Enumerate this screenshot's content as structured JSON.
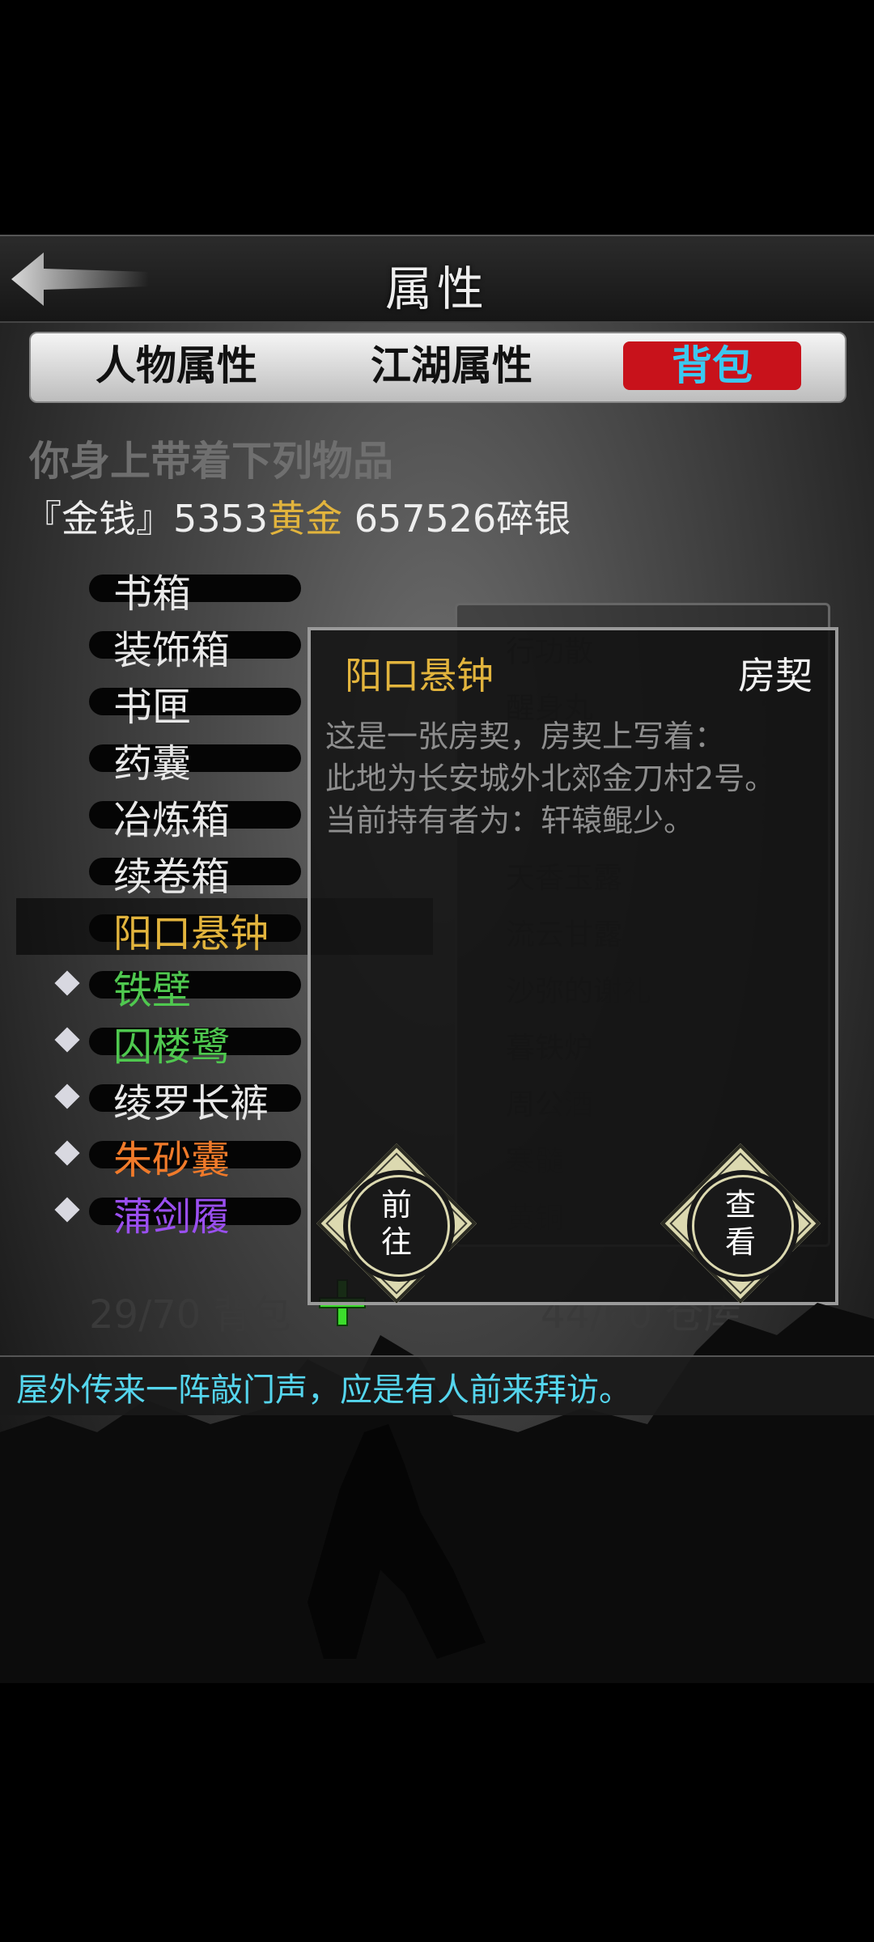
{
  "header": {
    "title": "属性"
  },
  "tabs": [
    {
      "label": "人物属性",
      "active": false
    },
    {
      "label": "江湖属性",
      "active": false
    },
    {
      "label": "背包",
      "active": true
    }
  ],
  "carry_text": "你身上带着下列物品",
  "money": {
    "prefix": "『金钱』",
    "gold_amount": "5353",
    "gold_label": "黄金",
    "silver": "657526碎银"
  },
  "items": [
    {
      "name": "书箱",
      "color": "#e8e8e8",
      "diamond": false
    },
    {
      "name": "装饰箱",
      "color": "#e8e8e8",
      "diamond": false
    },
    {
      "name": "书匣",
      "color": "#e8e8e8",
      "diamond": false
    },
    {
      "name": "药囊",
      "color": "#e8e8e8",
      "diamond": false
    },
    {
      "name": "冶炼箱",
      "color": "#e8e8e8",
      "diamond": false
    },
    {
      "name": "续卷箱",
      "color": "#e8e8e8",
      "diamond": false
    },
    {
      "name": "阳口悬钟",
      "color": "#e2b43d",
      "diamond": false,
      "selected": true
    },
    {
      "name": "铁壁",
      "color": "#4fc84f",
      "diamond": true
    },
    {
      "name": "囚楼鹭",
      "color": "#4fc84f",
      "diamond": true
    },
    {
      "name": "绫罗长裤",
      "color": "#e8e8e8",
      "diamond": true
    },
    {
      "name": "朱砂囊",
      "color": "#f07a2a",
      "diamond": true
    },
    {
      "name": "蒲剑履",
      "color": "#9a4ff0",
      "diamond": true
    }
  ],
  "warehouse": [
    {
      "name": "行功散",
      "qty": "40"
    },
    {
      "name": "醒身丸",
      "qty": "41"
    },
    {
      "name": "",
      "qty": "56"
    },
    {
      "name": "",
      "qty": "37"
    },
    {
      "name": "天香玉露",
      "qty": "17"
    },
    {
      "name": "流云甘露",
      "qty": "16"
    },
    {
      "name": "沙弥的谢礼",
      "qty": "1"
    },
    {
      "name": "暮铁炉",
      "qty": "1"
    },
    {
      "name": "周公酒",
      "qty": "1"
    },
    {
      "name": "寒髓",
      "qty": "1"
    },
    {
      "name": "黄铜",
      "qty": ""
    }
  ],
  "dialog": {
    "item_name": "阳口悬钟",
    "item_type": "房契",
    "description": [
      "这是一张房契，房契上写着：",
      "此地为长安城外北郊金刀村2号。",
      "当前持有者为：轩辕鲲少。"
    ],
    "go_label": "前\n往",
    "view_label": "查\n看"
  },
  "bag": {
    "count": "29/70 背包"
  },
  "store": {
    "count": "44/60 仓库"
  },
  "message": "屋外传来一阵敲门声，应是有人前来拜访。",
  "colors": {
    "gold": "#e2b43d",
    "tab_active_bg": "#c8121b",
    "tab_active_text": "#3bc8f0",
    "message": "#55d6ee"
  }
}
